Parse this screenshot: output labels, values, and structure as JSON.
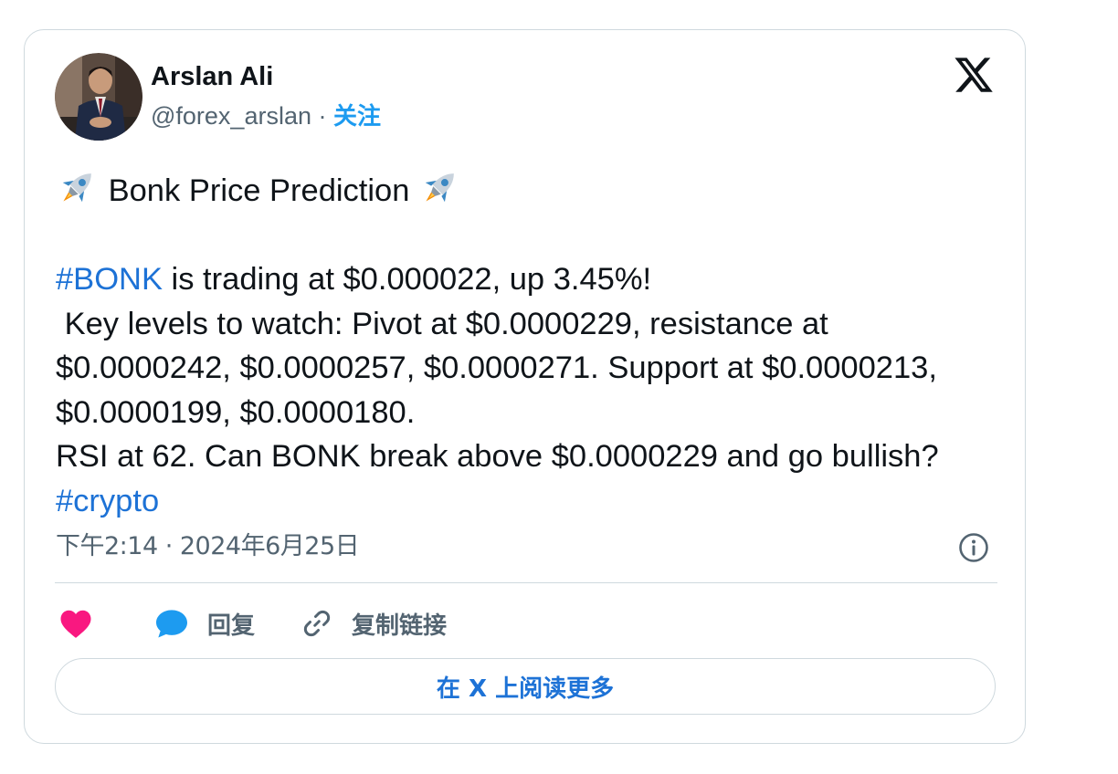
{
  "author": {
    "name": "Arslan Ali",
    "handle": "@forex_arslan",
    "separator": "·",
    "follow_label": "关注"
  },
  "tweet": {
    "headline_text": "Bonk Price Prediction",
    "hashtag_bonk": "#BONK",
    "line1_rest": " is trading at $0.000022, up 3.45%!",
    "line2": " Key levels to watch: Pivot at $0.0000229, resistance at $0.0000242, $0.0000257, $0.0000271. Support at $0.0000213, $0.0000199, $0.0000180.",
    "line3": "RSI at 62. Can BONK break above $0.0000229 and go bullish?  ",
    "hashtag_crypto": "#crypto",
    "headline_emoji": "rocket-emoji"
  },
  "meta": {
    "timestamp": "下午2:14 · 2024年6月25日"
  },
  "actions": {
    "like_icon": "heart-icon",
    "reply_label": "回复",
    "copy_link_label": "复制链接"
  },
  "footer": {
    "read_more_label": "在 X 上阅读更多"
  },
  "colors": {
    "link_blue": "#1d9bf0",
    "hashtag_blue": "#1d72d6",
    "like_pink": "#f91880",
    "muted_text": "#536471",
    "border": "#cfd9de"
  }
}
